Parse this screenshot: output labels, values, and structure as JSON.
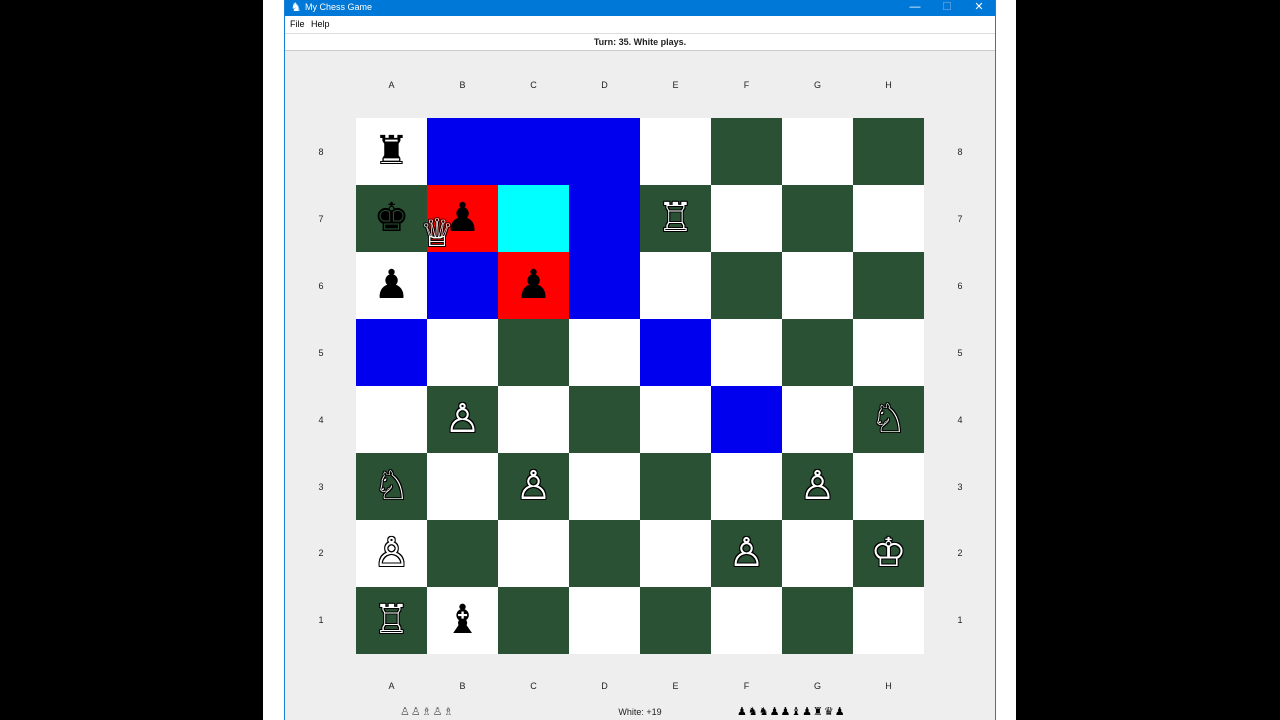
{
  "window": {
    "title": "My Chess Game",
    "minimize": "—",
    "maximize": "☐",
    "close": "✕",
    "app_icon": "♞"
  },
  "menu": {
    "file": "File",
    "help": "Help"
  },
  "status": {
    "text": "Turn: 35. White plays."
  },
  "files": [
    "A",
    "B",
    "C",
    "D",
    "E",
    "F",
    "G",
    "H"
  ],
  "ranks": [
    "8",
    "7",
    "6",
    "5",
    "4",
    "3",
    "2",
    "1"
  ],
  "board": [
    [
      {
        "c": "light",
        "p": "♜",
        "s": "black"
      },
      {
        "c": "move"
      },
      {
        "c": "move"
      },
      {
        "c": "move"
      },
      {
        "c": "light"
      },
      {
        "c": "dark"
      },
      {
        "c": "light"
      },
      {
        "c": "dark"
      }
    ],
    [
      {
        "c": "dark",
        "p": "♚",
        "s": "black"
      },
      {
        "c": "cap",
        "p": "♟",
        "s": "black"
      },
      {
        "c": "sel"
      },
      {
        "c": "move"
      },
      {
        "c": "dark",
        "p": "♖",
        "s": "white"
      },
      {
        "c": "light"
      },
      {
        "c": "dark"
      },
      {
        "c": "light"
      }
    ],
    [
      {
        "c": "light",
        "p": "♟",
        "s": "black"
      },
      {
        "c": "move"
      },
      {
        "c": "cap",
        "p": "♟",
        "s": "black"
      },
      {
        "c": "move"
      },
      {
        "c": "light"
      },
      {
        "c": "dark"
      },
      {
        "c": "light"
      },
      {
        "c": "dark"
      }
    ],
    [
      {
        "c": "move"
      },
      {
        "c": "light"
      },
      {
        "c": "dark"
      },
      {
        "c": "light"
      },
      {
        "c": "move"
      },
      {
        "c": "light"
      },
      {
        "c": "dark"
      },
      {
        "c": "light"
      }
    ],
    [
      {
        "c": "light"
      },
      {
        "c": "dark",
        "p": "♙",
        "s": "white"
      },
      {
        "c": "light"
      },
      {
        "c": "dark"
      },
      {
        "c": "light"
      },
      {
        "c": "move"
      },
      {
        "c": "light"
      },
      {
        "c": "dark",
        "p": "♘",
        "s": "white"
      }
    ],
    [
      {
        "c": "dark",
        "p": "♘",
        "s": "white"
      },
      {
        "c": "light"
      },
      {
        "c": "dark",
        "p": "♙",
        "s": "white"
      },
      {
        "c": "light"
      },
      {
        "c": "dark"
      },
      {
        "c": "light"
      },
      {
        "c": "dark",
        "p": "♙",
        "s": "white"
      },
      {
        "c": "light"
      }
    ],
    [
      {
        "c": "light",
        "p": "♙",
        "s": "white"
      },
      {
        "c": "dark"
      },
      {
        "c": "light"
      },
      {
        "c": "dark"
      },
      {
        "c": "light"
      },
      {
        "c": "dark",
        "p": "♙",
        "s": "white"
      },
      {
        "c": "light"
      },
      {
        "c": "dark",
        "p": "♔",
        "s": "white"
      }
    ],
    [
      {
        "c": "dark",
        "p": "♖",
        "s": "white"
      },
      {
        "c": "light",
        "p": "♝",
        "s": "black"
      },
      {
        "c": "dark"
      },
      {
        "c": "light"
      },
      {
        "c": "dark"
      },
      {
        "c": "light"
      },
      {
        "c": "dark"
      },
      {
        "c": "light"
      }
    ]
  ],
  "dragging_piece": {
    "glyph": "♕",
    "side": "white"
  },
  "colors": {
    "light": "#ffffff",
    "dark": "#2a5134",
    "move": "#0000ee",
    "capture": "#ff0000",
    "selected": "#00ffff"
  },
  "footer": {
    "captured_white": "♙♙♗♙♗",
    "score": "White: +19",
    "captured_black": "♟♞♞♟♟♝♟♜♛♟"
  }
}
